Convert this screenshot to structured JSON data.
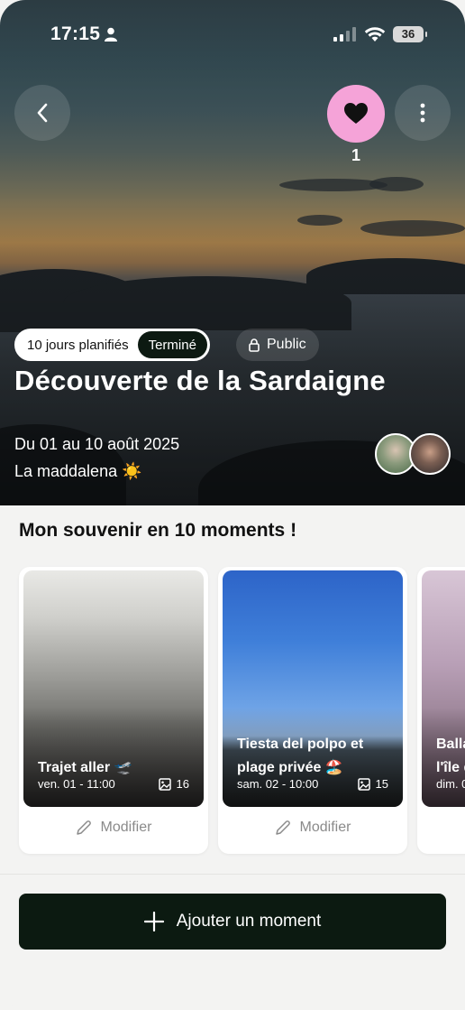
{
  "status_bar": {
    "time": "17:15",
    "battery": "36"
  },
  "header": {
    "like_count": "1",
    "icons": [
      "chevron-left-icon",
      "heart-icon",
      "more-vertical-icon"
    ],
    "like_color": "#f5a3d8"
  },
  "trip": {
    "planned_badge": "10 jours planifiés",
    "status_badge": "Terminé",
    "visibility": "Public",
    "title": "Découverte de la Sardaigne",
    "dates": "Du 01 au 10 août 2025",
    "place": "La maddalena ☀️"
  },
  "moments_section": {
    "title": "Mon souvenir en 10 moments !",
    "edit_label": "Modifier",
    "cards": [
      {
        "title_line1": "Trajet aller 🛫",
        "title_line2": "",
        "date": "ven. 01 - 11:00",
        "photo_count": "16"
      },
      {
        "title_line1": "Tiesta del polpo et",
        "title_line2": "plage privée 🏖️",
        "date": "sam. 02 - 10:00",
        "photo_count": "15"
      },
      {
        "title_line1": "Balla",
        "title_line2": "l'île d",
        "date": "dim. 0",
        "photo_count": ""
      }
    ]
  },
  "footer": {
    "add_button_label": "Ajouter un moment",
    "accent": "#0c1a11"
  }
}
